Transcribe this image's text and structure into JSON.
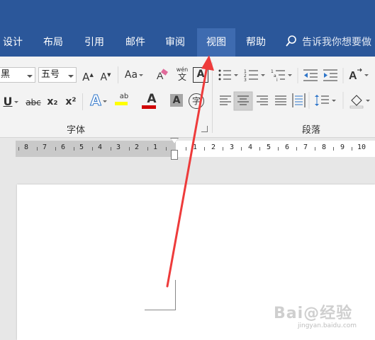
{
  "tabs": [
    {
      "label": "设计"
    },
    {
      "label": "布局"
    },
    {
      "label": "引用"
    },
    {
      "label": "邮件"
    },
    {
      "label": "审阅"
    },
    {
      "label": "视图",
      "active": true
    },
    {
      "label": "帮助"
    }
  ],
  "tell_me": {
    "placeholder": "告诉我你想要做"
  },
  "font": {
    "name_fragment": "黑",
    "size": "五号",
    "grow_label": "A",
    "shrink_label": "A",
    "case_label": "Aa",
    "phonetic_top": "wén",
    "phonetic_bottom": "文",
    "border_label": "A",
    "underline_label": "U",
    "strike_label": "abc",
    "subscript_label": "x₂",
    "superscript_label": "x²",
    "effects_label": "A",
    "highlight_label": "ab",
    "color_label": "A",
    "shade_label": "A",
    "enclose_label": "字",
    "group_label": "字体"
  },
  "paragraph": {
    "group_label": "段落"
  },
  "ruler": {
    "left_numbers": [
      "8",
      "7",
      "6",
      "5",
      "4",
      "3",
      "2",
      "1"
    ],
    "right_numbers": [
      "1",
      "2",
      "3",
      "4",
      "5",
      "6",
      "7",
      "8",
      "9",
      "10"
    ]
  },
  "watermark": {
    "line1": "Bai@经验",
    "line2": "jingyan.baidu.com"
  },
  "colors": {
    "brand": "#2b579a",
    "active_tab": "#3e6bb0",
    "arrow": "#ee3b3b",
    "highlight": "#ffff00",
    "font_color": "#d00000"
  }
}
